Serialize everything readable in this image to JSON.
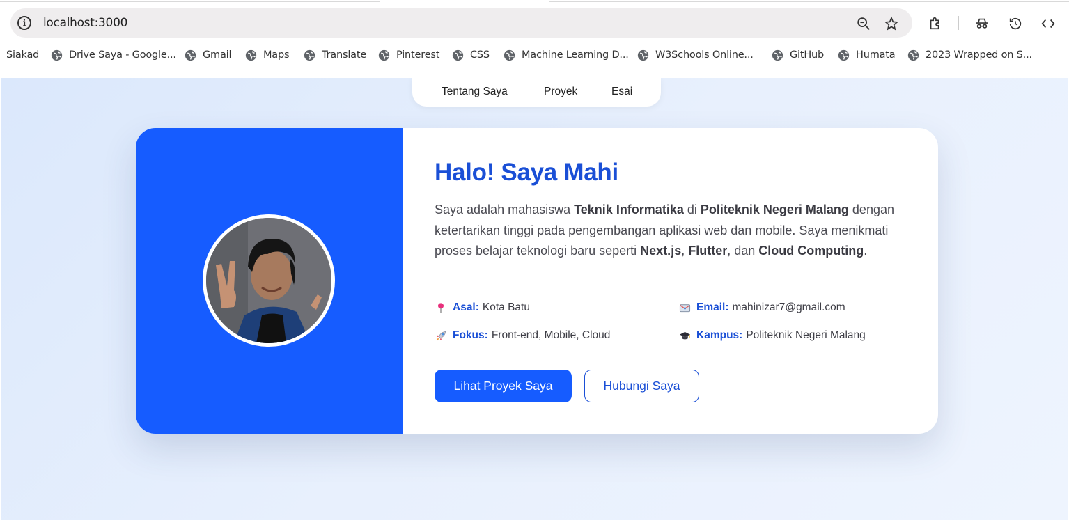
{
  "browser": {
    "url": "localhost:3000",
    "bookmarks": [
      {
        "label": "Siakad",
        "icon": "none"
      },
      {
        "label": "Drive Saya - Google...",
        "icon": "globe-icon"
      },
      {
        "label": "Gmail",
        "icon": "globe-icon"
      },
      {
        "label": "Maps",
        "icon": "globe-icon"
      },
      {
        "label": "Translate",
        "icon": "globe-icon"
      },
      {
        "label": "Pinterest",
        "icon": "globe-icon"
      },
      {
        "label": "CSS",
        "icon": "globe-icon"
      },
      {
        "label": "Machine Learning D...",
        "icon": "globe-icon"
      },
      {
        "label": "W3Schools Online...",
        "icon": "globe-icon"
      },
      {
        "label": "GitHub",
        "icon": "globe-icon"
      },
      {
        "label": "Humata",
        "icon": "globe-icon"
      },
      {
        "label": "2023 Wrapped on S...",
        "icon": "globe-icon"
      }
    ]
  },
  "nav": {
    "items": [
      "Tentang Saya",
      "Proyek",
      "Esai"
    ]
  },
  "profile": {
    "title": "Halo! Saya Mahi",
    "desc": {
      "p1": "Saya adalah mahasiswa ",
      "b1": "Teknik Informatika",
      "p2": " di ",
      "b2": "Politeknik Negeri Malang",
      "p3": " dengan ketertarikan tinggi pada pengembangan aplikasi web dan mobile. Saya menikmati proses belajar teknologi baru seperti ",
      "b3": "Next.js",
      "p4": ", ",
      "b4": "Flutter",
      "p5": ", dan ",
      "b5": "Cloud Computing",
      "p6": "."
    },
    "info": {
      "asal": {
        "label": "Asal:",
        "value": "Kota Batu",
        "icon": "round-pushpin-icon"
      },
      "email": {
        "label": "Email:",
        "value": "mahinizar7@gmail.com",
        "icon": "envelope-icon"
      },
      "fokus": {
        "label": "Fokus:",
        "value": "Front-end, Mobile, Cloud",
        "icon": "rocket-icon"
      },
      "kampus": {
        "label": "Kampus:",
        "value": "Politeknik Negeri Malang",
        "icon": "graduation-cap-icon"
      }
    },
    "buttons": {
      "primary": "Lihat Proyek Saya",
      "secondary": "Hubungi Saya"
    }
  },
  "colors": {
    "accent": "#165cff",
    "heading": "#1a4fd6",
    "background": "#e3edfd"
  }
}
